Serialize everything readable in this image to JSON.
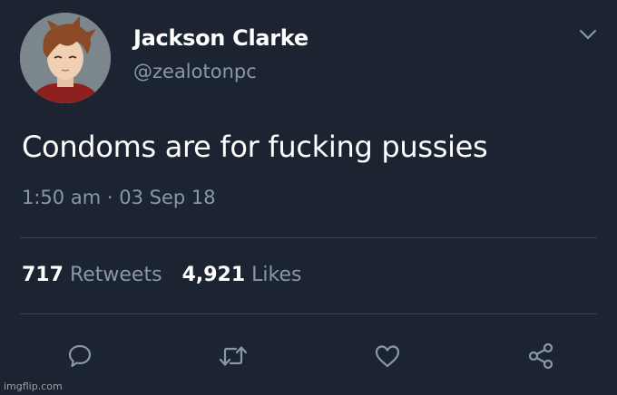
{
  "user": {
    "name": "Jackson Clarke",
    "handle": "@zealotonpc"
  },
  "tweet": {
    "text": "Condoms are for fucking pussies",
    "time": "1:50 am",
    "separator": "·",
    "date": "03 Sep 18"
  },
  "stats": {
    "retweets_count": "717",
    "retweets_label": "Retweets",
    "likes_count": "4,921",
    "likes_label": "Likes"
  },
  "actions": {
    "icons": [
      "reply-icon",
      "retweet-icon",
      "like-icon",
      "share-icon"
    ]
  },
  "watermark": "imgflip.com",
  "colors": {
    "background": "#1b2430",
    "text": "#ffffff",
    "muted": "#8899a6",
    "divider": "#38444d"
  }
}
